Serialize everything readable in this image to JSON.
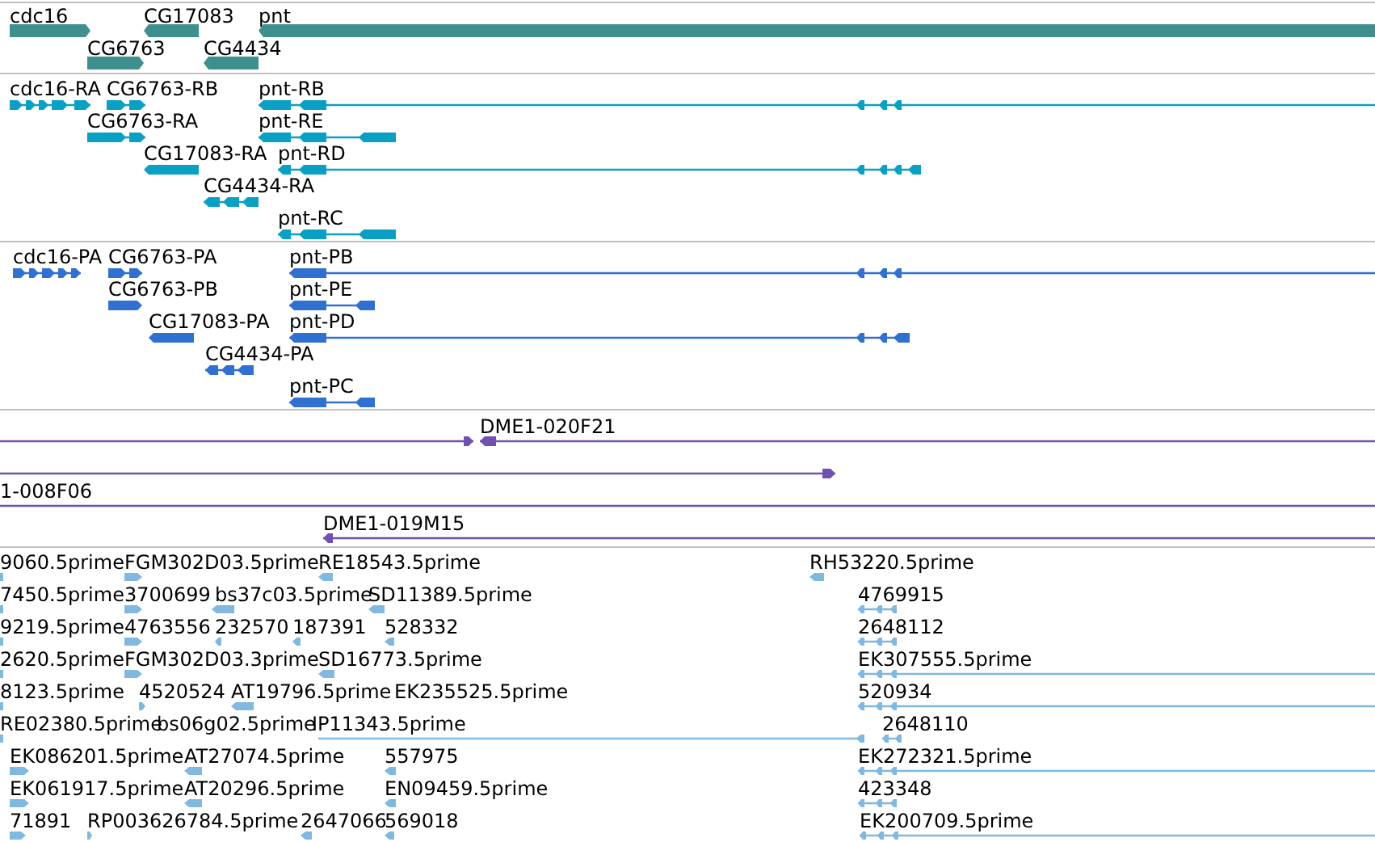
{
  "tracks": [
    {
      "kind": "gene",
      "color": "#3f8f8f",
      "features": [
        {
          "label": "cdc16",
          "reverse": false
        },
        {
          "label": "CG17083",
          "reverse": true
        },
        {
          "label": "pnt",
          "reverse": true
        },
        {
          "label": "CG6763",
          "reverse": false
        },
        {
          "label": "CG4434",
          "reverse": true
        }
      ]
    },
    {
      "kind": "transcript",
      "color": "#0aa0c4",
      "features": [
        {
          "label": "cdc16-RA",
          "reverse": false
        },
        {
          "label": "CG6763-RB",
          "reverse": false
        },
        {
          "label": "pnt-RB",
          "reverse": true
        },
        {
          "label": "CG6763-RA",
          "reverse": false
        },
        {
          "label": "pnt-RE",
          "reverse": true
        },
        {
          "label": "CG17083-RA",
          "reverse": true
        },
        {
          "label": "pnt-RD",
          "reverse": true
        },
        {
          "label": "CG4434-RA",
          "reverse": true
        },
        {
          "label": "pnt-RC",
          "reverse": true
        }
      ]
    },
    {
      "kind": "transcript",
      "color": "#3070d0",
      "features": [
        {
          "label": "cdc16-PA",
          "reverse": false
        },
        {
          "label": "CG6763-PA",
          "reverse": false
        },
        {
          "label": "pnt-PB",
          "reverse": true
        },
        {
          "label": "CG6763-PB",
          "reverse": false
        },
        {
          "label": "pnt-PE",
          "reverse": true
        },
        {
          "label": "CG17083-PA",
          "reverse": true
        },
        {
          "label": "pnt-PD",
          "reverse": true
        },
        {
          "label": "CG4434-PA",
          "reverse": true
        },
        {
          "label": "pnt-PC",
          "reverse": true
        }
      ]
    },
    {
      "kind": "clone",
      "color": "#7050b0",
      "features": [
        {
          "reverse": false
        },
        {
          "label": "DME1-020F21",
          "reverse": true
        },
        {
          "reverse": false
        },
        {
          "label": "1-008F06"
        },
        {
          "label": "DME1-019M15",
          "reverse": true
        }
      ]
    },
    {
      "kind": "est",
      "color": "#80b8e0",
      "features": [
        {
          "label": "9060.5prime"
        },
        {
          "label": "FGM302D03.5prime",
          "reverse": false
        },
        {
          "label": "RE18543.5prime",
          "reverse": true
        },
        {
          "label": "RH53220.5prime",
          "reverse": true
        },
        {
          "label": "7450.5prime"
        },
        {
          "label": "3700699",
          "reverse": false
        },
        {
          "label": "bs37c03.5prime",
          "reverse": true
        },
        {
          "label": "SD11389.5prime",
          "reverse": true
        },
        {
          "label": "4769915",
          "reverse": true
        },
        {
          "label": "9219.5prime"
        },
        {
          "label": "4763556",
          "reverse": false
        },
        {
          "label": "232570",
          "reverse": true
        },
        {
          "label": "187391",
          "reverse": true
        },
        {
          "label": "528332",
          "reverse": true
        },
        {
          "label": "2648112",
          "reverse": true
        },
        {
          "label": "2620.5prime"
        },
        {
          "label": "FGM302D03.3prime",
          "reverse": false
        },
        {
          "label": "SD16773.5prime",
          "reverse": true
        },
        {
          "label": "EK307555.5prime",
          "reverse": true
        },
        {
          "label": "8123.5prime"
        },
        {
          "label": "4520524",
          "reverse": false
        },
        {
          "label": "AT19796.5prime",
          "reverse": true
        },
        {
          "label": "EK235525.5prime"
        },
        {
          "label": "520934",
          "reverse": true
        },
        {
          "label": "RE02380.5prime"
        },
        {
          "label": "bs06g02.5prime"
        },
        {
          "label": "IP11343.5prime",
          "reverse": true
        },
        {
          "label": "2648110",
          "reverse": true
        },
        {
          "label": "EK086201.5prime",
          "reverse": false
        },
        {
          "label": "AT27074.5prime",
          "reverse": true
        },
        {
          "label": "557975",
          "reverse": true
        },
        {
          "label": "EK272321.5prime",
          "reverse": true
        },
        {
          "label": "EK061917.5prime",
          "reverse": false
        },
        {
          "label": "AT20296.5prime",
          "reverse": true
        },
        {
          "label": "EN09459.5prime",
          "reverse": true
        },
        {
          "label": "423348",
          "reverse": true
        },
        {
          "label": "71891",
          "reverse": false
        },
        {
          "label": "RP003626784.5prime",
          "reverse": false
        },
        {
          "label": "2647066",
          "reverse": true
        },
        {
          "label": "569018",
          "reverse": true
        },
        {
          "label": "EK200709.5prime",
          "reverse": true
        }
      ]
    }
  ]
}
